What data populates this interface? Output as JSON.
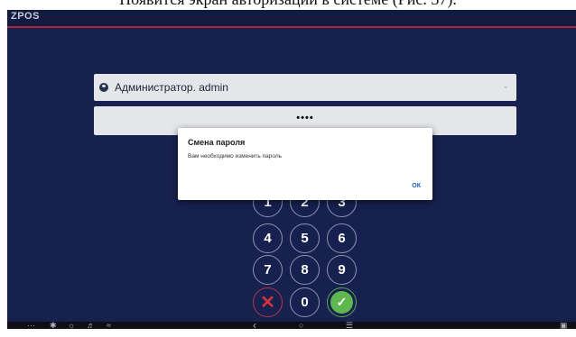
{
  "caption": "Появится экран авторизации в системе (Рис. 37).",
  "app": {
    "brand": "ZPOS"
  },
  "login": {
    "user": "Администратор. admin",
    "password_mask": "••••"
  },
  "keypad": {
    "digits": [
      "1",
      "2",
      "3",
      "4",
      "5",
      "6",
      "7",
      "8",
      "9",
      "0"
    ]
  },
  "dialog": {
    "title": "Смена пароля",
    "message": "Вам необходимо изменить пароль",
    "ok_label": "ОК"
  },
  "navbar": {
    "status_icons": [
      "dots-icon",
      "bluetooth-icon",
      "brightness-icon",
      "volume-icon",
      "wifi-icon"
    ],
    "nav_buttons": [
      "back-icon",
      "home-icon",
      "menu-icon",
      "window-icon"
    ]
  }
}
